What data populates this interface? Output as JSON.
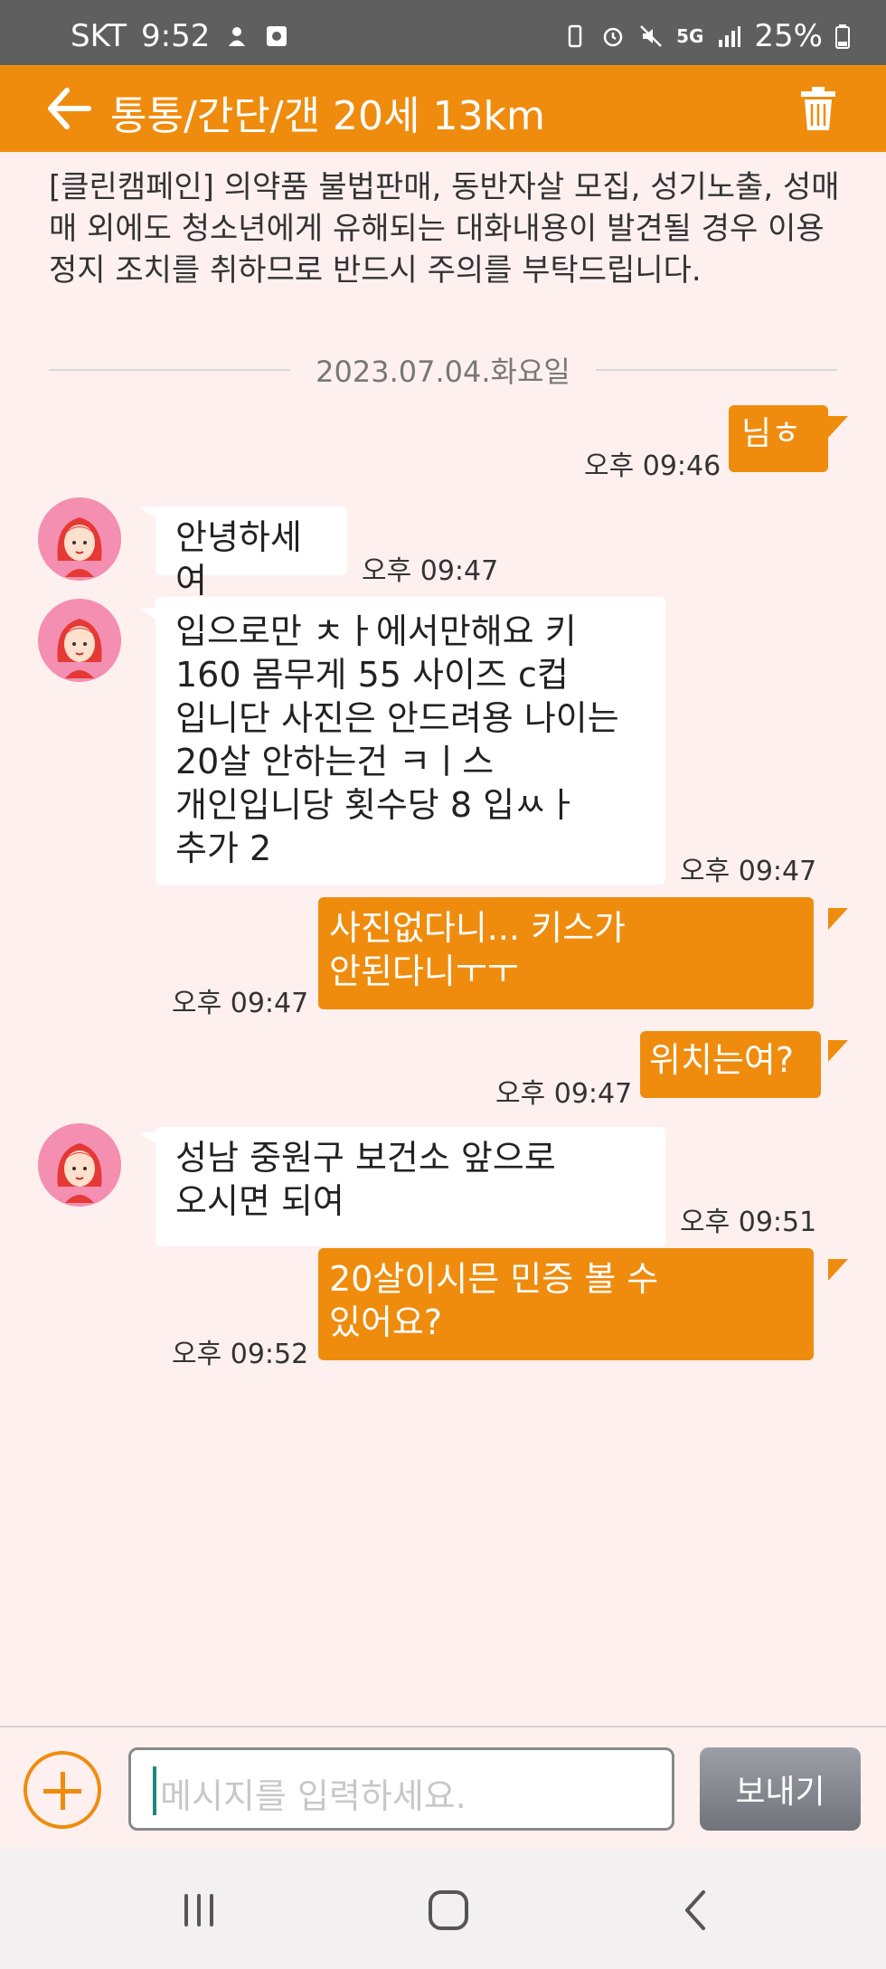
{
  "status_bar": {
    "carrier": "SKT",
    "time": "9:52",
    "network": "5G",
    "battery": "25%"
  },
  "header": {
    "title": "통통/간단/갠 20세 13km",
    "color": "#ef8c0e"
  },
  "notice": "[클린캠페인] 의약품 불법판매, 동반자살 모집, 성기노출, 성매매 외에도 청소년에게 유해되는 대화내용이 발견될 경우 이용정지 조치를 취하므로 반드시 주의를 부탁드립니다.",
  "date_divider": "2023.07.04.화요일",
  "messages": [
    {
      "dir": "out",
      "text": "님ㅎ",
      "time": "오후 09:46"
    },
    {
      "dir": "in",
      "text": "안녕하세여",
      "time": "오후 09:47"
    },
    {
      "dir": "in",
      "lines": [
        "입으로만 ㅊㅏ에서만해요 키",
        "160 몸무게 55 사이즈 c컵",
        "입니단 사진은 안드려용 나이는",
        "20살 안하는건 ㅋㅣ스",
        "개인입니당  횟수당 8 입ㅆㅏ",
        "추가 2"
      ],
      "time": "오후 09:47"
    },
    {
      "dir": "out",
      "lines": [
        "사진없다니... 키스가",
        "안된다니ㅜㅜ"
      ],
      "time": "오후 09:47"
    },
    {
      "dir": "out",
      "text": "위치는여?",
      "time": "오후 09:47"
    },
    {
      "dir": "in",
      "lines": [
        "성남 중원구 보건소 앞으로",
        "오시면 되여"
      ],
      "time": "오후 09:51"
    },
    {
      "dir": "out",
      "lines": [
        "20살이시믄 민증 볼 수",
        "있어요?"
      ],
      "time": "오후 09:52"
    }
  ],
  "input": {
    "placeholder": "메시지를 입력하세요.",
    "send_label": "보내기"
  },
  "icons": {
    "back": "arrow-left-icon",
    "delete": "trash-icon",
    "attach": "plus-circle-icon",
    "nav": [
      "recents-icon",
      "home-icon",
      "back-nav-icon"
    ]
  }
}
